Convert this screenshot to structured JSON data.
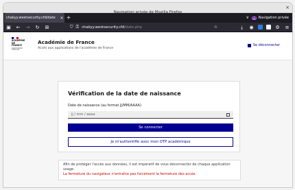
{
  "window": {
    "title": "Navigation privée de Mozilla Firefox",
    "close_glyph": "×"
  },
  "tabs": [
    {
      "label": "chakyy.westsecurity.cfd/date",
      "close_glyph": "×"
    }
  ],
  "tabstrip": {
    "new_tab_glyph": "+",
    "list_glyph": "∨",
    "private_label": "Navigation privée"
  },
  "navbar": {
    "url_domain": "chakyy.westsecurity.cfd",
    "url_path": "/date.php"
  },
  "header": {
    "logo_lines": [
      "ACADÉMIE",
      "DE FRANCE"
    ],
    "logo_motto": "Liberté Égalité Fraternité",
    "site_name": "Académie de France",
    "site_tagline": "Accès aux applications de l'académie de France",
    "logout_label": "Se déconnecter"
  },
  "form": {
    "title": "Vérification de la date de naissance",
    "date_label": "Date de naissance (au format JJ/MM/AAAA)",
    "date_value": "jj / mm / aaaa",
    "submit_label": "Se connecter",
    "otp_label": "Je m'authentifie avec mon OTP académique"
  },
  "notice": {
    "text": "Afin de protéger l'accès aux données, il est impératif de vous déconnecter de chaque application usage.",
    "warning": "La fermeture du navigateur n'entraîne pas forcément la fermeture des accès."
  },
  "colors": {
    "brand_blue": "#000091",
    "warning_red": "#ce0500",
    "private_purple": "#c069ff",
    "flag_blue": "#000091",
    "flag_white": "#ffffff",
    "flag_red": "#e1000f"
  }
}
